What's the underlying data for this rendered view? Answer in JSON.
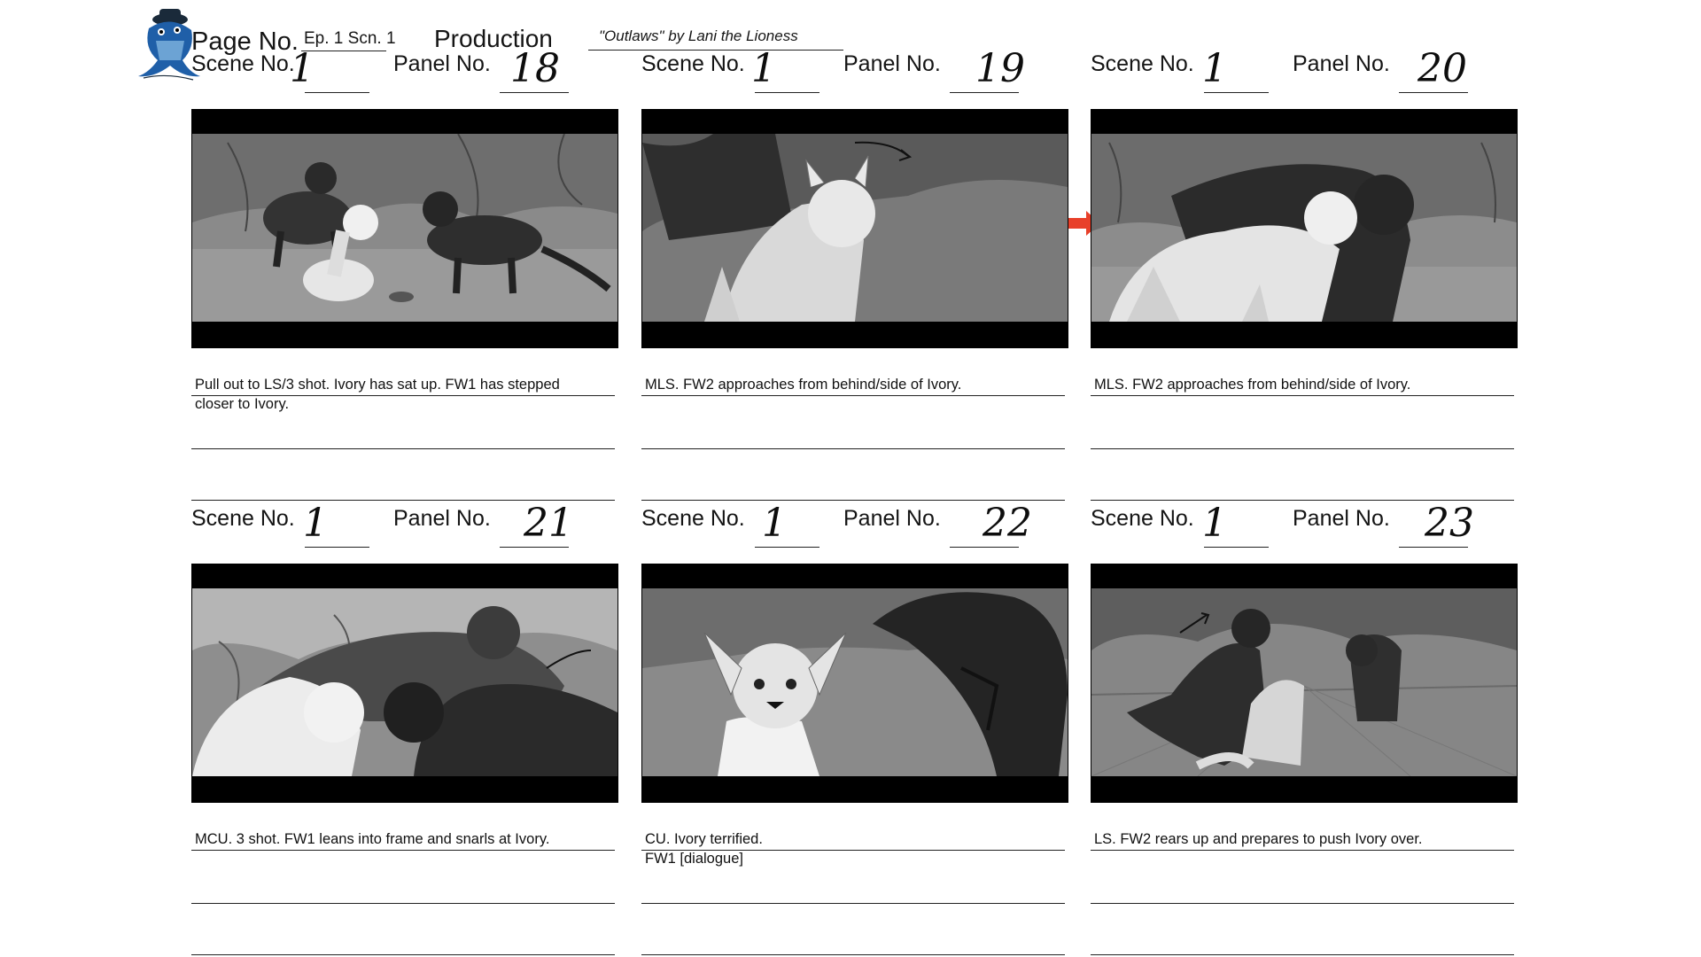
{
  "header": {
    "page_no_label": "Page No.",
    "page_no_value": "Ep. 1 Scn. 1",
    "production_label": "Production",
    "production_value": "\"Outlaws\" by Lani the Lioness"
  },
  "panels": [
    {
      "scene_label": "Scene No.",
      "scene_no": "1",
      "panel_label": "Panel No.",
      "panel_no": "18",
      "desc1": "Pull out to LS/3 shot. Ivory has sat up. FW1 has stepped",
      "desc2": "closer to Ivory."
    },
    {
      "scene_label": "Scene No.",
      "scene_no": "1",
      "panel_label": "Panel No.",
      "panel_no": "19",
      "desc1": "MLS. FW2 approaches from behind/side of Ivory.",
      "desc2": ""
    },
    {
      "scene_label": "Scene No.",
      "scene_no": "1",
      "panel_label": "Panel No.",
      "panel_no": "20",
      "desc1": "MLS. FW2 approaches from behind/side of Ivory.",
      "desc2": ""
    },
    {
      "scene_label": "Scene No.",
      "scene_no": "1",
      "panel_label": "Panel No.",
      "panel_no": "21",
      "desc1": "MCU. 3 shot. FW1 leans into frame and snarls at Ivory.",
      "desc2": ""
    },
    {
      "scene_label": "Scene No.",
      "scene_no": "1",
      "panel_label": "Panel No.",
      "panel_no": "22",
      "desc1": "CU. Ivory terrified.",
      "desc2": "FW1 [dialogue]"
    },
    {
      "scene_label": "Scene No.",
      "scene_no": "1",
      "panel_label": "Panel No.",
      "panel_no": "23",
      "desc1": "LS. FW2 rears up and prepares to push Ivory over.",
      "desc2": ""
    }
  ],
  "colors": {
    "accent_arrow": "#e8402a",
    "logo_blue": "#1f5fa8",
    "frame_black": "#000000"
  },
  "icons": [
    "fish-mascot-logo",
    "transition-arrow-icon"
  ]
}
